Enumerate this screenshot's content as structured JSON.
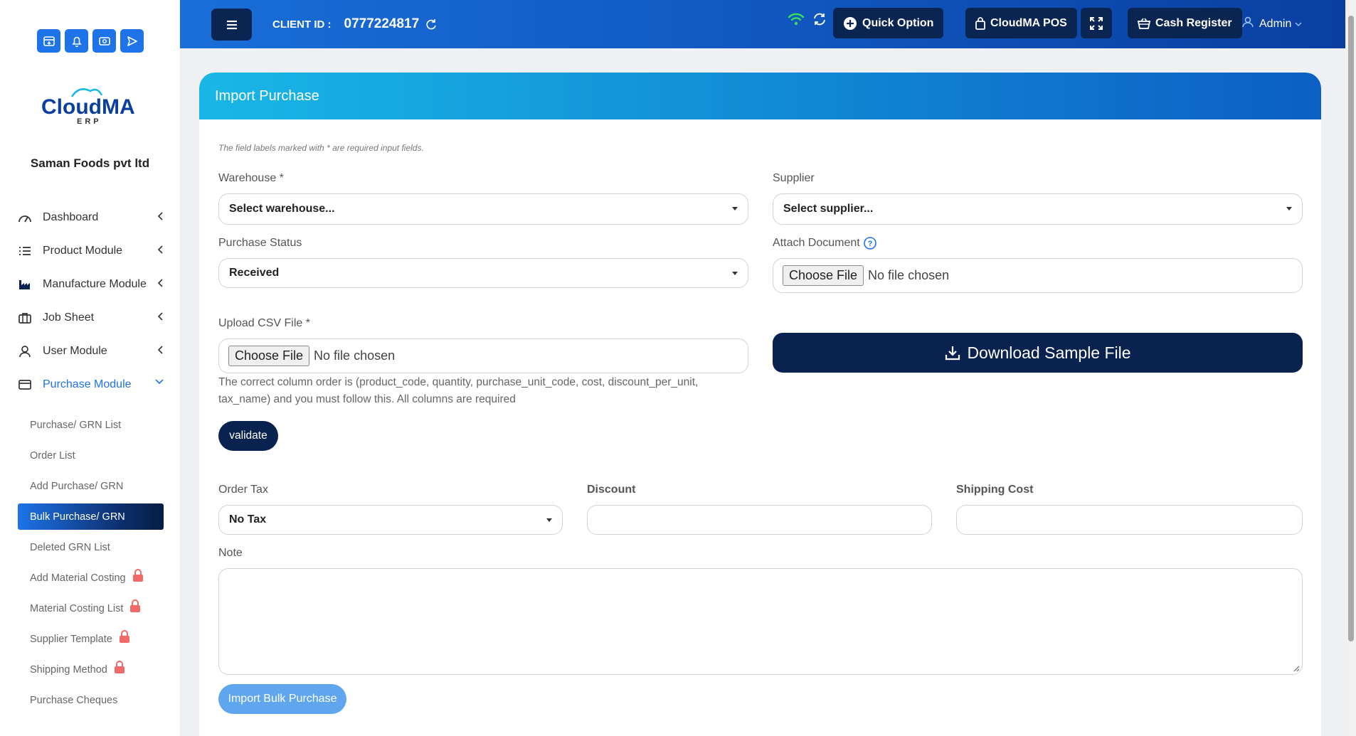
{
  "sidebar": {
    "company": "Saman Foods pvt ltd",
    "logo_text": "CloudMA",
    "logo_sub": "ERP",
    "nav": [
      {
        "label": "Dashboard",
        "icon": "gauge-icon"
      },
      {
        "label": "Product Module",
        "icon": "list-icon"
      },
      {
        "label": "Manufacture Module",
        "icon": "factory-icon"
      },
      {
        "label": "Job Sheet",
        "icon": "briefcase-icon"
      },
      {
        "label": "User Module",
        "icon": "user-icon"
      },
      {
        "label": "Purchase Module",
        "icon": "card-icon"
      }
    ],
    "subnav": [
      {
        "label": "Purchase/ GRN List"
      },
      {
        "label": "Order List"
      },
      {
        "label": "Add Purchase/ GRN"
      },
      {
        "label": "Bulk Purchase/ GRN"
      },
      {
        "label": "Deleted GRN List"
      },
      {
        "label": "Add Material Costing"
      },
      {
        "label": "Material Costing List"
      },
      {
        "label": "Supplier Template"
      },
      {
        "label": "Shipping Method"
      },
      {
        "label": "Purchase Cheques"
      }
    ]
  },
  "header": {
    "client_label": "CLIENT ID :",
    "client_id": "0777224817",
    "quick_option": "Quick Option",
    "pos": "CloudMA POS",
    "cash_register": "Cash Register",
    "admin": "Admin"
  },
  "form": {
    "title": "Import Purchase",
    "required_note": "The field labels marked with * are required input fields.",
    "warehouse_label": "Warehouse *",
    "warehouse_value": "Select warehouse...",
    "supplier_label": "Supplier",
    "supplier_value": "Select supplier...",
    "status_label": "Purchase Status",
    "status_value": "Received",
    "attach_label": "Attach Document",
    "choose_file": "Choose File",
    "no_file": "No file chosen",
    "csv_label": "Upload CSV File *",
    "download_sample": "Download Sample File",
    "csv_hint": "The correct column order is (product_code, quantity, purchase_unit_code, cost, discount_per_unit, tax_name) and you must follow this. All columns are required",
    "validate": "validate",
    "order_tax_label": "Order Tax",
    "order_tax_value": "No Tax",
    "discount_label": "Discount",
    "shipping_label": "Shipping Cost",
    "note_label": "Note",
    "import_button": "Import Bulk Purchase"
  },
  "colors": {
    "accent": "#1e73e8",
    "dark_navy": "#0a2250",
    "lock": "#f06a6a"
  }
}
